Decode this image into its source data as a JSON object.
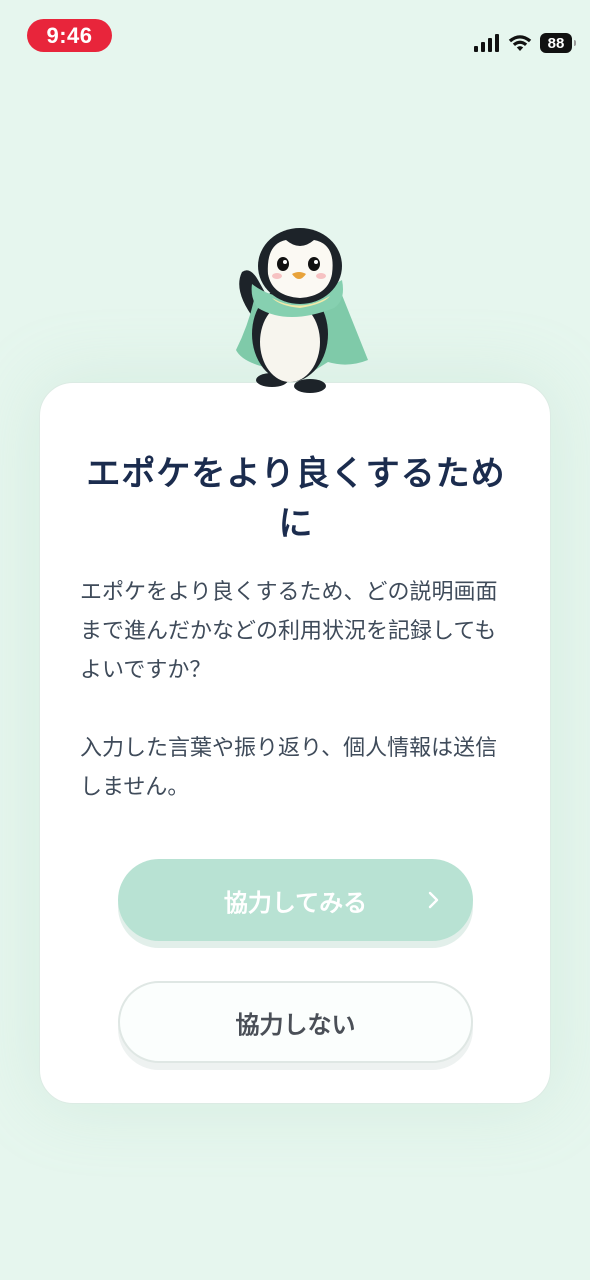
{
  "status_bar": {
    "time": "9:46",
    "battery": "88",
    "icons": [
      "signal-icon",
      "wifi-icon",
      "battery-icon"
    ]
  },
  "mascot": {
    "icon": "penguin-mascot"
  },
  "dialog": {
    "title": "エポケをより良くするために",
    "body_paragraph_1": "エポケをより良くするため、どの説明画面まで進んだかなどの利用状況を記録してもよいですか？",
    "body_paragraph_2": "入力した言葉や振り返り、個人情報は送信しません。",
    "accept_label": "協力してみる",
    "decline_label": "協力しない"
  },
  "colors": {
    "background": "#e6f6ee",
    "time_pill": "#e8253b",
    "title": "#1b2c4e",
    "primary_button": "#b8e2d3",
    "mascot_cape": "#7fcaa9"
  }
}
